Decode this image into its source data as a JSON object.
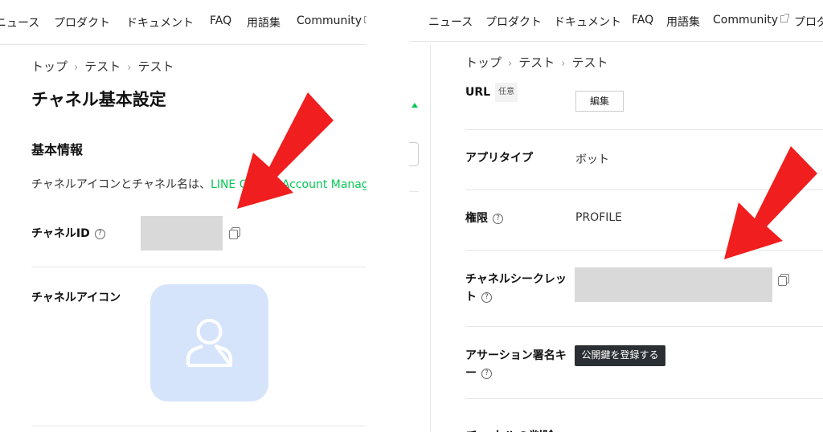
{
  "left": {
    "nav": [
      {
        "label": "ニュース",
        "external": false
      },
      {
        "label": "プロダクト",
        "external": false
      },
      {
        "label": "ドキュメント",
        "external": false
      },
      {
        "label": "FAQ",
        "external": false
      },
      {
        "label": "用語集",
        "external": false
      },
      {
        "label": "Community",
        "external": true
      }
    ],
    "breadcrumb": [
      "トップ",
      "テスト",
      "テスト"
    ],
    "page_title": "チャネル基本設定",
    "section_title": "基本情報",
    "description_prefix": "チャネルアイコンとチャネル名は、",
    "description_link": "LINE Official Account Manager",
    "channel_id_label": "チャネルID",
    "channel_icon_label": "チャネルアイコン"
  },
  "right": {
    "nav": [
      {
        "label": "ニュース",
        "external": false
      },
      {
        "label": "プロダクト",
        "external": false
      },
      {
        "label": "ドキュメント",
        "external": false
      },
      {
        "label": "FAQ",
        "external": false
      },
      {
        "label": "用語集",
        "external": false
      },
      {
        "label": "Community",
        "external": true
      },
      {
        "label": "プロダクト",
        "external": false
      }
    ],
    "breadcrumb": [
      "トップ",
      "テスト",
      "テスト"
    ],
    "url_label": "URL",
    "url_badge": "任意",
    "edit_button": "編集",
    "app_type_label": "アプリタイプ",
    "app_type_value": "ボット",
    "permission_label": "権限",
    "permission_value": "PROFILE",
    "channel_secret_label_line1": "チャネルシークレッ",
    "channel_secret_label_line2": "ト",
    "assertion_label_line1": "アサーション署名キ",
    "assertion_label_line2": "ー",
    "register_key_button": "公開鍵を登録する",
    "delete_section_title": "チャネルの削除"
  },
  "icons": {
    "help": "?",
    "breadcrumb_separator": "›",
    "copy": "copy-icon",
    "user": "user-silhouette-icon",
    "annotation_arrow": "red-arrow-icon"
  },
  "colors": {
    "link_green": "#06c755",
    "annotation_red": "#f01e1e",
    "masked_gray": "#d9d9d9",
    "avatar_bg": "#d6e4fb",
    "dark_button": "#2b2f33"
  }
}
